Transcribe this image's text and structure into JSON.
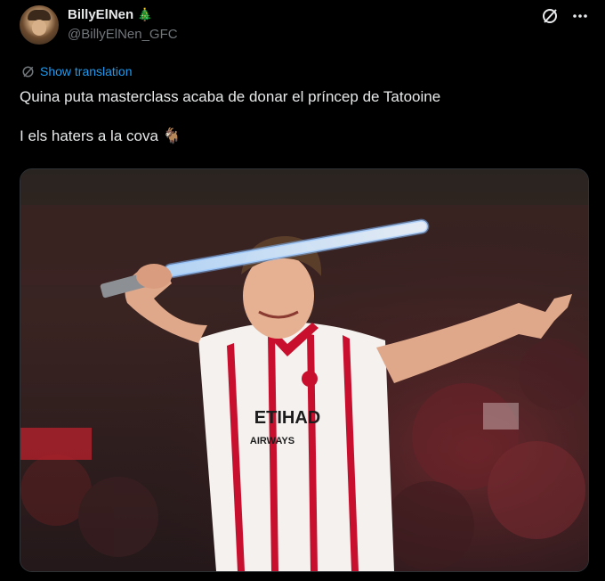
{
  "author": {
    "name": "BillyElNen",
    "badge": "🎄",
    "handle": "@BillyElNen_GFC"
  },
  "actions": {
    "grok_icon": "slash-circle-icon",
    "more_icon": "more-icon"
  },
  "translation": {
    "label": "Show translation"
  },
  "post": {
    "line1": "Quina puta masterclass acaba de donar el príncep de Tatooine",
    "line2": "I els haters a la cova 🐐"
  },
  "media": {
    "shirt_sponsor": "ETIHAD",
    "shirt_sponsor_sub": "AIRWAYS",
    "colors": {
      "shirt": "#f4f1ee",
      "stripe": "#c8102e",
      "saber": "#cfe6ff",
      "crowd": "#5a1a1f"
    }
  }
}
